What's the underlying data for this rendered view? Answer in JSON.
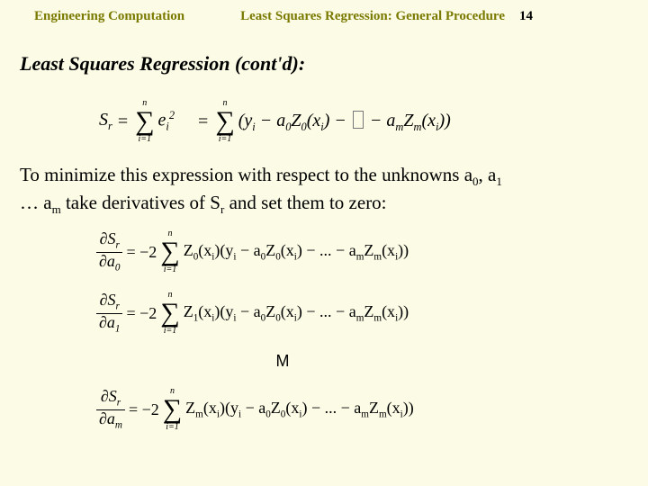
{
  "header": {
    "left": "Engineering Computation",
    "mid": "Least Squares Regression: General Procedure",
    "page": "14"
  },
  "section_title": "Least Squares Regression (cont'd):",
  "sr": {
    "lhs": "S",
    "lhs_sub": "r",
    "eq": "=",
    "sum_top": "n",
    "sum_bot": "i=1",
    "term1_base": "e",
    "term1_sub": "i",
    "term1_sup": "2",
    "rhs_open": "(y",
    "rhs_yi_sub": "i",
    "rhs_mid1": " − a",
    "rhs_a0_sub": "0",
    "rhs_mid2": "Z",
    "rhs_z0_sub": "0",
    "rhs_mid3": "(x",
    "rhs_xi_sub": "i",
    "rhs_mid4": ") − ",
    "rhs_mid5": " − a",
    "rhs_am_sub": "m",
    "rhs_mid6": "Z",
    "rhs_zm_sub": "m",
    "rhs_mid7": "(x",
    "rhs_close": "))"
  },
  "body": {
    "p1a": "To minimize this expression with respect to the unknowns a",
    "s0": "0",
    "p1b": ", a",
    "s1": "1",
    "p1c": " … a",
    "sm": "m",
    "p1d": " take derivatives of S",
    "sr": "r",
    "p1e": " and set them to zero:"
  },
  "deriv": {
    "dS": "∂S",
    "r": "r",
    "da": "∂a",
    "k0": "0",
    "k1": "1",
    "km": "m",
    "eq": " = −2",
    "sum_top": "n",
    "sum_bot": "i=1",
    "Z": "Z",
    "x_open": "(x",
    "xi": "i",
    "x_close": ")",
    "y_open": "(y",
    "mid1": " − a",
    "a0": "0",
    "mid2": " − ... − a",
    "am": "m",
    "close": "))",
    "vdots": "M"
  }
}
